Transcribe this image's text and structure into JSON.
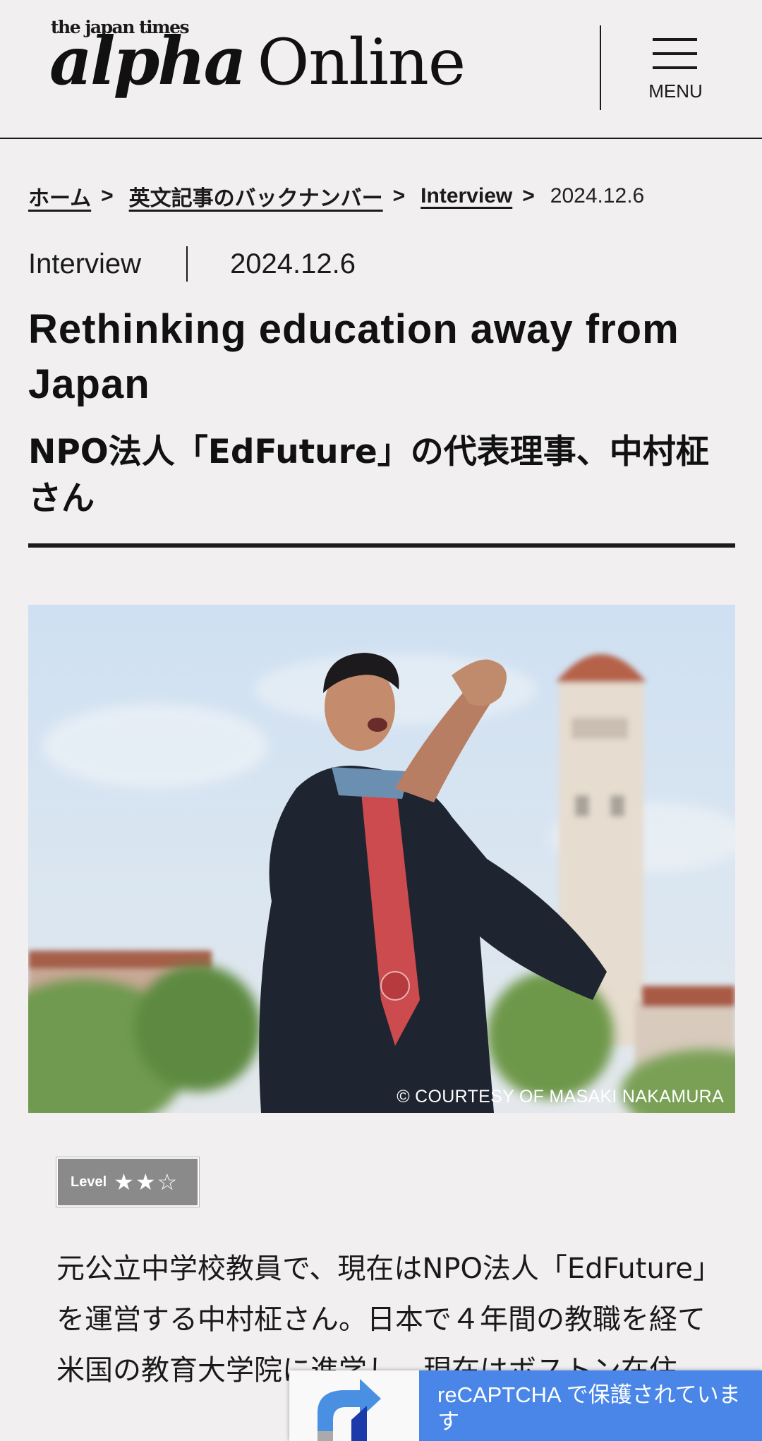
{
  "header": {
    "brand_top": "the japan times",
    "brand_alpha": "alpha",
    "brand_online": "Online",
    "menu_label": "MENU"
  },
  "breadcrumb": {
    "items": [
      "ホーム",
      "英文記事のバックナンバー",
      "Interview"
    ],
    "separator": ">",
    "current": "2024.12.6"
  },
  "article": {
    "category": "Interview",
    "date": "2024.12.6",
    "title": "Rethinking education away from Japan",
    "subtitle": "NPO法人「EdFuture」の代表理事、中村柾さん",
    "image_credit": "© COURTESY OF MASAKI NAKAMURA",
    "level_label": "Level",
    "level_stars": "★★☆",
    "level_value": 2,
    "level_max": 3,
    "body": "元公立中学校教員で、現在はNPO法人「EdFuture」を運営する中村柾さん。日本で４年間の教職を経て米国の教育大学院に進学し、現在はボストン在住。"
  },
  "recaptcha": {
    "text": "reCAPTCHA で保護されています"
  },
  "colors": {
    "background": "#f1eff0",
    "text": "#1a1a1a",
    "badge": "#8a8a8a",
    "recaptcha_blue": "#4a86e8"
  }
}
